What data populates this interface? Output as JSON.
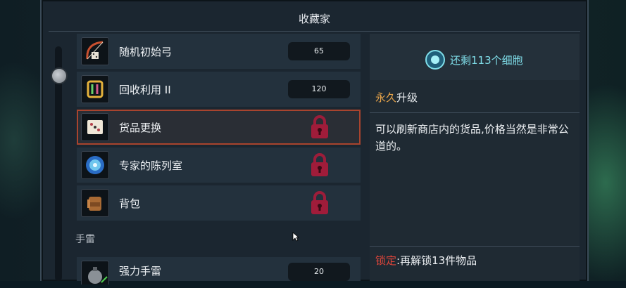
{
  "window": {
    "title": "收藏家"
  },
  "items": [
    {
      "label": "随机初始弓",
      "cost": "65",
      "icon": "bow-icon",
      "locked": false
    },
    {
      "label": "回收利用 II",
      "cost": "120",
      "icon": "recycle-icon",
      "locked": false
    },
    {
      "label": "货品更换",
      "icon": "dice-icon",
      "locked": true,
      "selected": true
    },
    {
      "label": "专家的陈列室",
      "icon": "portal-icon",
      "locked": true
    },
    {
      "label": "背包",
      "icon": "backpack-icon",
      "locked": true
    }
  ],
  "section": {
    "label": "手雷"
  },
  "grenade_item": {
    "label": "强力手雷",
    "cost": "20",
    "icon": "grenade-icon"
  },
  "cells": {
    "text": "还剩113个细胞",
    "icon": "cell-icon"
  },
  "detail": {
    "prefix": "永久",
    "suffix": "升级",
    "description": "可以刷新商店内的货品,价格当然是非常公道的。",
    "lock_label": "锁定",
    "lock_text": ":再解锁13件物品"
  },
  "colors": {
    "accent_orange": "#e6a34a",
    "lock_red": "#e0453a",
    "cells_cyan": "#7fdde8",
    "selection_border": "#a9442e"
  }
}
